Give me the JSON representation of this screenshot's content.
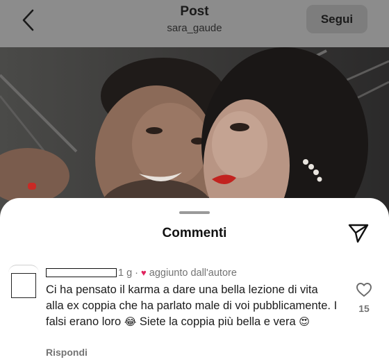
{
  "header": {
    "title": "Post",
    "username": "sara_gaude",
    "follow_label": "Segui"
  },
  "sheet": {
    "title": "Commenti"
  },
  "comment": {
    "meta": "1 g · ",
    "author_badge": "aggiunto dall'autore",
    "text_part1": "Ci ha pensato il karma a dare una bella lezione di vita alla ex coppia che ha parlato male di voi pubblicamente. I falsi erano loro ",
    "emoji1": "😂",
    "text_part2": " Siete la coppia più bella e vera ",
    "emoji2": "😍",
    "likes": "15",
    "reply_label": "Rispondi"
  },
  "icons": {
    "back": "chevron-left-icon",
    "share": "paper-plane-icon",
    "like": "heart-outline-icon",
    "author_heart": "heart-filled-icon"
  },
  "colors": {
    "author_heart": "#e0245e",
    "meta_text": "#737373"
  }
}
